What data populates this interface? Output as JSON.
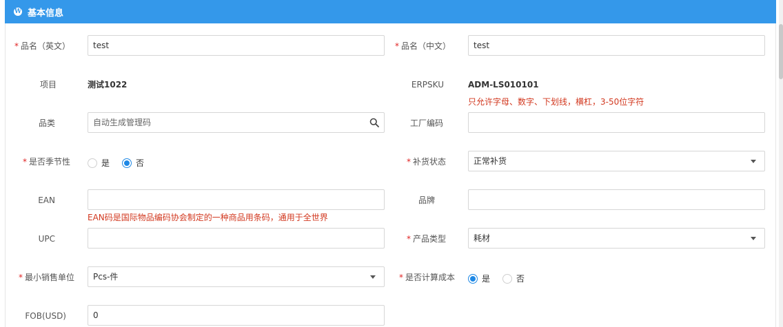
{
  "header": {
    "title": "基本信息"
  },
  "fields": {
    "name_en": {
      "label": "品名（英文）",
      "value": "test"
    },
    "name_cn": {
      "label": "品名（中文）",
      "value": "test"
    },
    "project": {
      "label": "项目",
      "value": "测试1022"
    },
    "erpsku": {
      "label": "ERPSKU",
      "value": "ADM-LS010101",
      "hint": "只允许字母、数字、下划线，横杠，3-50位字符"
    },
    "category": {
      "label": "品类",
      "placeholder": "自动生成管理码"
    },
    "factory_code": {
      "label": "工厂编码",
      "value": ""
    },
    "seasonal": {
      "label": "是否季节性",
      "options": [
        "是",
        "否"
      ],
      "selected": "否"
    },
    "restock_status": {
      "label": "补货状态",
      "value": "正常补货"
    },
    "ean": {
      "label": "EAN",
      "value": "",
      "hint": "EAN码是国际物品编码协会制定的一种商品用条码，通用于全世界"
    },
    "brand": {
      "label": "品牌",
      "value": ""
    },
    "upc": {
      "label": "UPC",
      "value": ""
    },
    "product_type": {
      "label": "产品类型",
      "value": "耗材"
    },
    "min_sale_unit": {
      "label": "最小销售单位",
      "value": "Pcs-件"
    },
    "calc_cost": {
      "label": "是否计算成本",
      "options": [
        "是",
        "否"
      ],
      "selected": "是"
    },
    "fob": {
      "label": "FOB(USD)",
      "value": "0"
    }
  }
}
